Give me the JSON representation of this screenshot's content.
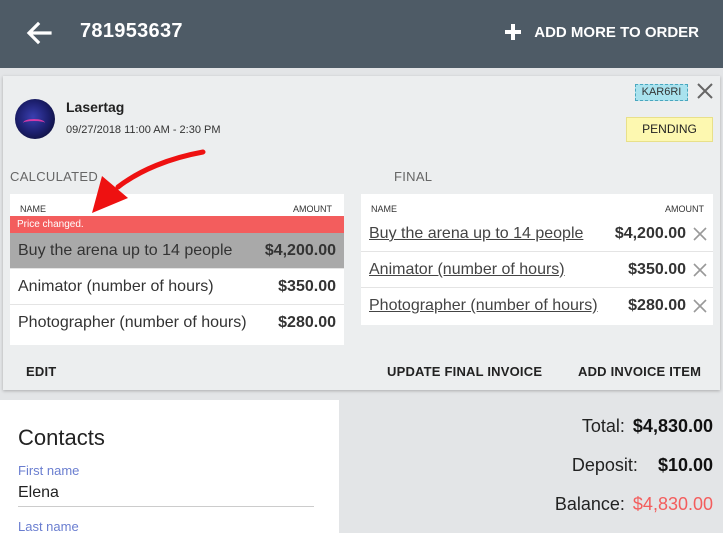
{
  "header": {
    "order_id": "781953637",
    "add_more_label": "ADD MORE TO ORDER"
  },
  "event": {
    "title": "Lasertag",
    "time": "09/27/2018 11:00 AM - 2:30 PM",
    "code": "KAR6RI",
    "status": "PENDING"
  },
  "calculated": {
    "label": "CALCULATED",
    "col_name": "NAME",
    "col_amount": "AMOUNT",
    "banner": "Price changed.",
    "items": [
      {
        "name": "Buy the arena up to 14 people",
        "amount": "$4,200.00"
      },
      {
        "name": "Animator (number of hours)",
        "amount": "$350.00"
      },
      {
        "name": "Photographer (number of hours)",
        "amount": "$280.00"
      }
    ]
  },
  "final": {
    "label": "FINAL",
    "col_name": "NAME",
    "col_amount": "AMOUNT",
    "items": [
      {
        "name": "Buy the arena up to 14 people",
        "amount": "$4,200.00"
      },
      {
        "name": "Animator (number of hours)",
        "amount": "$350.00"
      },
      {
        "name": "Photographer (number of hours)",
        "amount": "$280.00"
      }
    ]
  },
  "actions": {
    "edit": "EDIT",
    "update_final": "UPDATE FINAL INVOICE",
    "add_item": "ADD INVOICE ITEM"
  },
  "contacts": {
    "title": "Contacts",
    "first_name_label": "First name",
    "first_name_value": "Elena",
    "last_name_label": "Last name"
  },
  "totals": {
    "total_label": "Total:",
    "total_value": "$4,830.00",
    "deposit_label": "Deposit:",
    "deposit_value": "$10.00",
    "balance_label": "Balance:",
    "balance_value": "$4,830.00"
  },
  "colors": {
    "header_bg": "#4e5b66",
    "alert_red": "#f35d5d",
    "pending_yellow": "#fdf8b0",
    "code_cyan": "#a9e2ee",
    "field_label_blue": "#6a7ed0"
  },
  "icons": [
    "back-arrow-icon",
    "plus-icon",
    "close-icon",
    "remove-icon",
    "annotation-arrow"
  ]
}
